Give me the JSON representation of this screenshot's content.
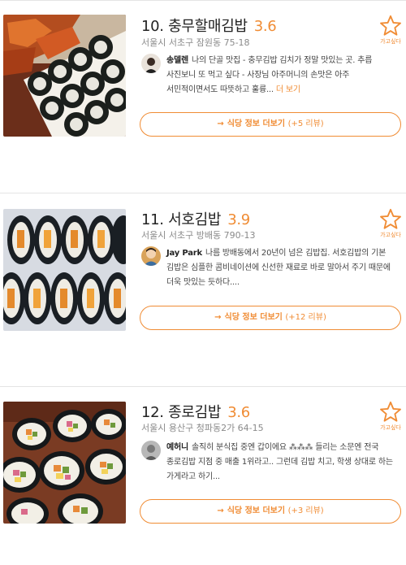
{
  "star_label": "가고싶다",
  "restaurants": [
    {
      "number": "10.",
      "name": "충무할매김밥",
      "score": "3.6",
      "address": "서울시 서초구 잠원동 75-18",
      "reviewer": "송델렌",
      "review": "나의 단골 맛집 - 충무김밥 김치가 정말 맛있는 곳. 추릅 사진보니 또 먹고 싶다 - 사장님 아주머니의 손맛은 아주 서민적이면서도 따뜻하고 훌륭...",
      "more": "더 보기",
      "button_label": "식당 정보 더보기",
      "button_count": "(+5 리뷰)"
    },
    {
      "number": "11.",
      "name": "서호김밥",
      "score": "3.9",
      "address": "서울시 서초구 방배동 790-13",
      "reviewer": "Jay Park",
      "review": "나름 방배동에서 20년이 넘은 김밥집. 서호김밥의 기본 김밥은 심플한 콤비네이션에 신선한 재료로 바로 말아서 주기 때문에 더욱 맛있는 듯하다....",
      "more": "",
      "button_label": "식당 정보 더보기",
      "button_count": "(+12 리뷰)"
    },
    {
      "number": "12.",
      "name": "종로김밥",
      "score": "3.6",
      "address": "서울시 용산구 청파동2가 64-15",
      "reviewer": "예허니",
      "review": "솔직히 분식집 중엔 갑이에요 ⁂⁂⁂ 들리는 소문엔 전국 종로김밥 지점 중 매출 1위라고.. 그런데 김밥 치고, 학생 상대로 하는 가게라고 하기...",
      "more": "",
      "button_label": "식당 정보 더보기",
      "button_count": "(+3 리뷰)"
    }
  ]
}
